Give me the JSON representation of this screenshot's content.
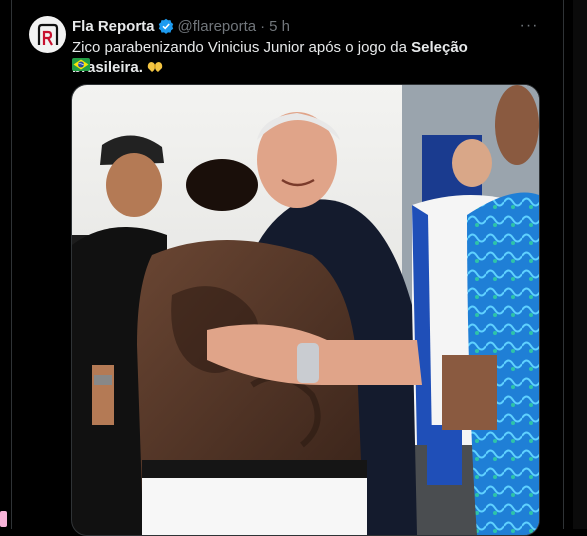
{
  "post": {
    "author_name": "Fla Reporta",
    "author_handle": "@flareporta",
    "separator": "·",
    "time": "5 h",
    "more_label": "···",
    "text_before": "Zico parabenizando Vinicius Junior após o jogo da ",
    "text_bold": "Seleção brasileira.",
    "media_alt": "Zico abraçando Vinicius Junior no vestiário da Seleção"
  },
  "icons": {
    "avatar": "fla-reporta-logo",
    "verified": "verified-badge-icon",
    "more": "more-options-icon",
    "emoji": "heart-hands-emoji",
    "flag": "brazil-flag-emoji"
  },
  "colors": {
    "background": "#000000",
    "text": "#e7e9ea",
    "muted": "#71767b",
    "verified": "#1d9bf0",
    "emoji": "#f4c542"
  }
}
